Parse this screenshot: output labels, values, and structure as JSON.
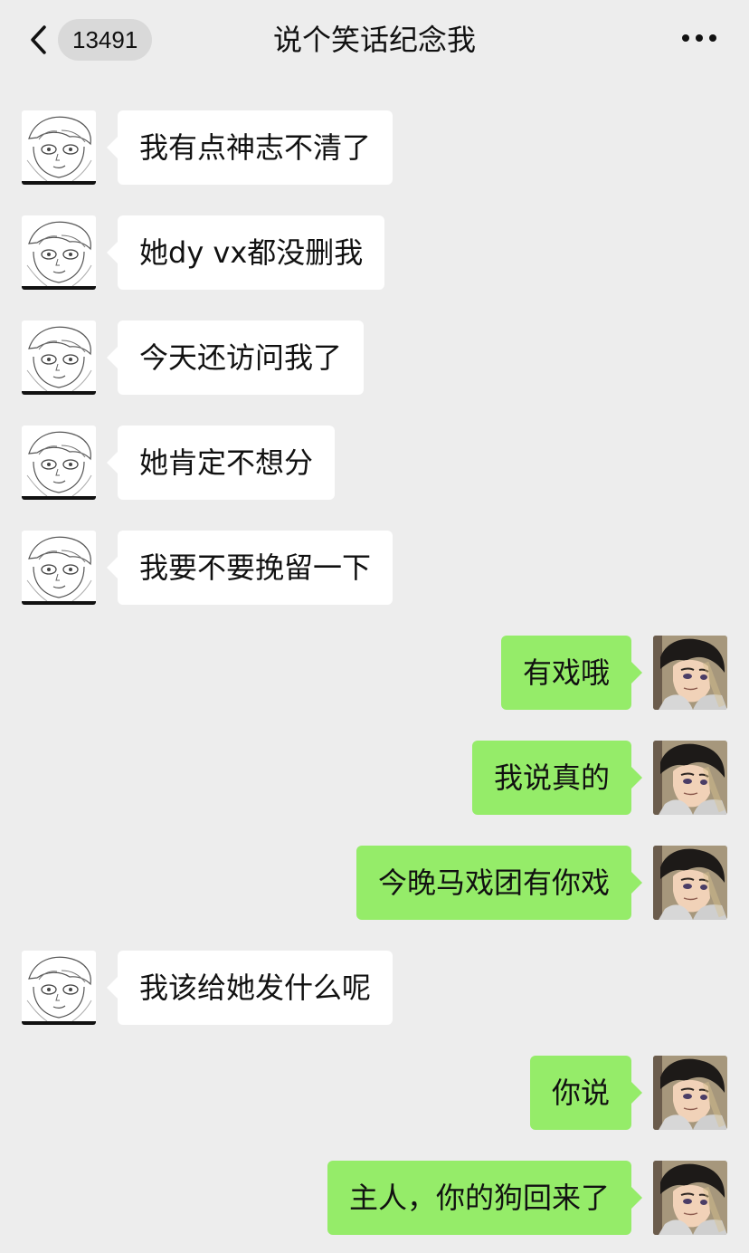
{
  "header": {
    "back_icon": "chevron-left-icon",
    "unread_count": "13491",
    "title": "说个笑话纪念我",
    "more_icon": "more-horizontal-icon"
  },
  "colors": {
    "background": "#ededed",
    "incoming_bubble": "#ffffff",
    "outgoing_bubble": "#95ec69",
    "text": "#111111"
  },
  "messages": [
    {
      "side": "left",
      "text": "我有点神志不清了"
    },
    {
      "side": "left",
      "text": "她dy vx都没删我"
    },
    {
      "side": "left",
      "text": "今天还访问我了"
    },
    {
      "side": "left",
      "text": "她肯定不想分"
    },
    {
      "side": "left",
      "text": "我要不要挽留一下"
    },
    {
      "side": "right",
      "text": "有戏哦"
    },
    {
      "side": "right",
      "text": "我说真的"
    },
    {
      "side": "right",
      "text": "今晚马戏团有你戏"
    },
    {
      "side": "left",
      "text": "我该给她发什么呢"
    },
    {
      "side": "right",
      "text": "你说"
    },
    {
      "side": "right",
      "text": "主人，你的狗回来了"
    }
  ]
}
